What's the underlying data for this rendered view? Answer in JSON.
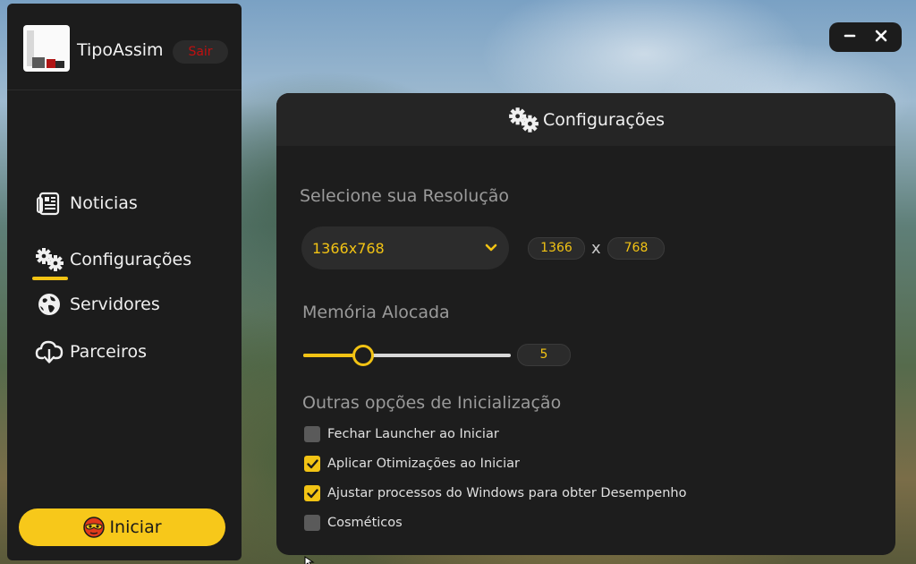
{
  "profile": {
    "username": "TipoAssim",
    "logout_label": "Sair"
  },
  "nav": {
    "items": [
      {
        "label": "Noticias",
        "icon": "newspaper-icon"
      },
      {
        "label": "Configurações",
        "icon": "gears-icon",
        "active": true
      },
      {
        "label": "Servidores",
        "icon": "globe-icon"
      },
      {
        "label": "Parceiros",
        "icon": "cloud-download-icon"
      }
    ],
    "start_label": "Iniciar",
    "start_icon": "mask-icon"
  },
  "window": {
    "minimize_icon": "minimize-icon",
    "close_icon": "close-icon"
  },
  "settings": {
    "title": "Configurações",
    "resolution": {
      "section_title": "Selecione sua Resolução",
      "selected": "1366x768",
      "width": "1366",
      "separator": "x",
      "height": "768"
    },
    "memory": {
      "section_title": "Memória Alocada",
      "value": "5",
      "slider_fraction": 0.29
    },
    "startup": {
      "section_title": "Outras opções de Inicialização",
      "options": [
        {
          "label": "Fechar Launcher ao Iniciar",
          "checked": false
        },
        {
          "label": "Aplicar Otimizações ao Iniciar",
          "checked": true
        },
        {
          "label": "Ajustar processos do Windows para obter Desempenho",
          "checked": true
        },
        {
          "label": "Cosméticos",
          "checked": false
        }
      ]
    }
  },
  "colors": {
    "accent": "#f2c314",
    "panel": "#1d1d1d",
    "sidebar": "#1c1c1c",
    "logout": "#c01010"
  }
}
